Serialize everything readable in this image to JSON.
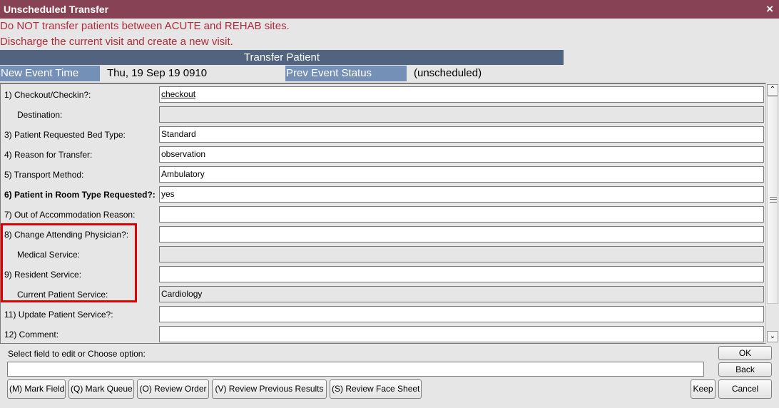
{
  "window": {
    "title": "Unscheduled Transfer",
    "close_icon": "×"
  },
  "warnings": [
    "Do NOT transfer patients between ACUTE and REHAB sites.",
    "Discharge the current visit and create a new visit."
  ],
  "section": {
    "title": "Transfer Patient"
  },
  "info": {
    "new_event_time_label": "New Event Time",
    "new_event_time_value": "Thu, 19 Sep 19  0910",
    "prev_event_status_label": "Prev Event Status",
    "prev_event_status_value": "(unscheduled)"
  },
  "fields": [
    {
      "label": "1)  Checkout/Checkin?:",
      "value": "checkout",
      "state": "link"
    },
    {
      "label": "Destination:",
      "value": "",
      "state": "disabled"
    },
    {
      "label": "3)  Patient Requested Bed Type:",
      "value": "Standard",
      "state": "normal"
    },
    {
      "label": "4)  Reason for Transfer:",
      "value": "observation",
      "state": "normal"
    },
    {
      "label": "5)  Transport Method:",
      "value": "Ambulatory",
      "state": "normal"
    },
    {
      "label": "6)  Patient in Room Type Requested?:",
      "value": "yes",
      "state": "normal"
    },
    {
      "label": "7)  Out of Accommodation Reason:",
      "value": "",
      "state": "normal"
    },
    {
      "label": "8)  Change Attending Physician?:",
      "value": "",
      "state": "normal"
    },
    {
      "label": "Medical Service:",
      "value": "",
      "state": "disabled"
    },
    {
      "label": "9)  Resident Service:",
      "value": "",
      "state": "normal"
    },
    {
      "label": "Current Patient Service:",
      "value": "Cardiology",
      "state": "disabled"
    },
    {
      "label": "11)  Update Patient Service?:",
      "value": "",
      "state": "normal"
    },
    {
      "label": "12)  Comment:",
      "value": "",
      "state": "normal"
    }
  ],
  "scrollbar": {
    "up_icon": "⌃",
    "down_icon": "⌄"
  },
  "prompt": {
    "label": "Select field to edit or Choose option:",
    "value": ""
  },
  "buttons": {
    "mark_field": "(M) Mark Field",
    "mark_queue": "(Q) Mark Queue",
    "review_order": "(O) Review Order",
    "review_previous_results": "(V) Review Previous Results",
    "review_face_sheet": "(S) Review Face Sheet",
    "keep": "Keep",
    "ok": "OK",
    "back": "Back",
    "cancel": "Cancel"
  },
  "colors": {
    "titlebar": "#874256",
    "warning_text": "#b02b3a",
    "section_header": "#52637f",
    "info_label": "#7590b6",
    "highlight": "#e00000"
  }
}
